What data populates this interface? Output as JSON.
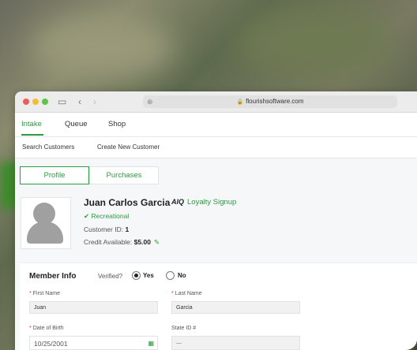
{
  "browser": {
    "url": "flourishsoftware.com"
  },
  "nav": {
    "tabs": [
      "Intake",
      "Queue",
      "Shop"
    ]
  },
  "subnav": {
    "items": [
      "Search Customers",
      "Create New Customer"
    ]
  },
  "profile_tabs": {
    "profile": "Profile",
    "purchases": "Purchases"
  },
  "customer": {
    "name": "Juan Carlos Garcia",
    "loyalty_label": "Loyalty Signup",
    "loyalty_logo": "AIQ",
    "type": "Recreational",
    "id_label": "Customer ID:",
    "id_value": "1",
    "credit_label": "Credit Available:",
    "credit_value": "$5.00"
  },
  "member_info": {
    "title": "Member Info",
    "verified_label": "Verified?",
    "yes": "Yes",
    "no": "No",
    "verified": "yes",
    "first_name_label": "First Name",
    "first_name": "Juan",
    "last_name_label": "Last Name",
    "last_name": "Garcia",
    "dob_label": "Date of Birth",
    "dob": "10/25/2001",
    "state_id_label": "State ID #",
    "state_id": "—"
  },
  "colors": {
    "accent": "#2c9a41"
  }
}
